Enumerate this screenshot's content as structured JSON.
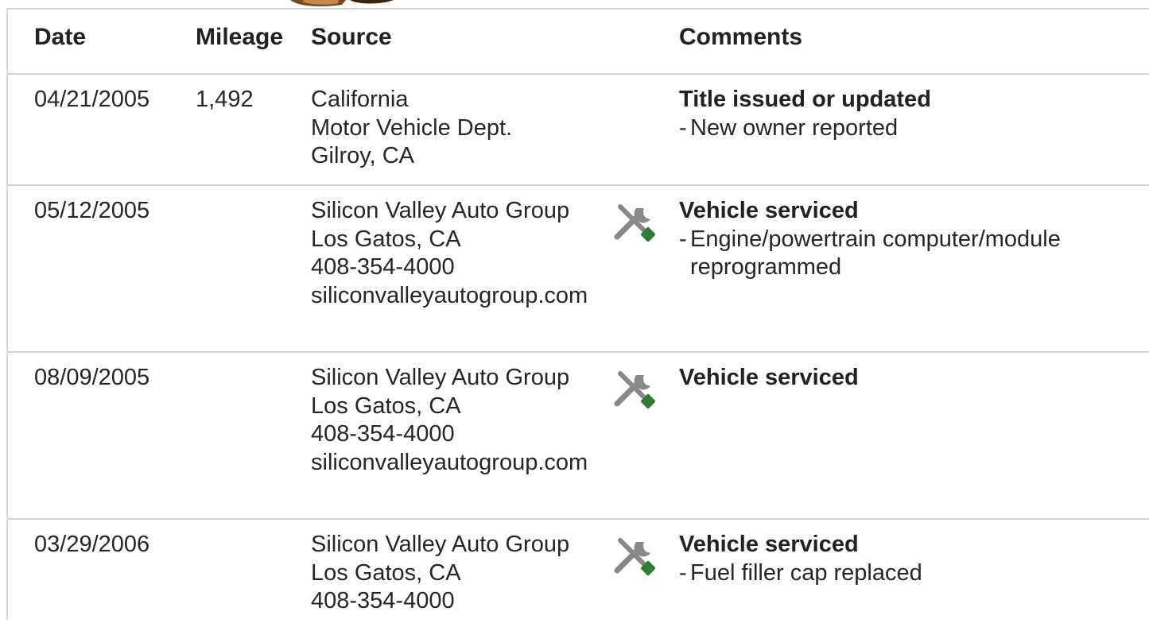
{
  "columns": {
    "date": "Date",
    "mileage": "Mileage",
    "source": "Source",
    "comments": "Comments"
  },
  "rows": [
    {
      "date": "04/21/2005",
      "mileage": "1,492",
      "source": [
        "California",
        "Motor Vehicle Dept.",
        "Gilroy, CA"
      ],
      "icon": "",
      "comment_title": "Title issued or updated",
      "comment_items": [
        "New owner reported"
      ]
    },
    {
      "date": "05/12/2005",
      "mileage": "",
      "source": [
        "Silicon Valley Auto Group",
        "Los Gatos, CA",
        "408-354-4000",
        "siliconvalleyautogroup.com"
      ],
      "icon": "service-wrench-icon",
      "comment_title": "Vehicle serviced",
      "comment_items": [
        "Engine/powertrain computer/module reprogrammed"
      ]
    },
    {
      "date": "08/09/2005",
      "mileage": "",
      "source": [
        "Silicon Valley Auto Group",
        "Los Gatos, CA",
        "408-354-4000",
        "siliconvalleyautogroup.com"
      ],
      "icon": "service-wrench-icon",
      "comment_title": "Vehicle serviced",
      "comment_items": []
    },
    {
      "date": "03/29/2006",
      "mileage": "",
      "source": [
        "Silicon Valley Auto Group",
        "Los Gatos, CA",
        "408-354-4000"
      ],
      "icon": "service-wrench-icon",
      "comment_title": "Vehicle serviced",
      "comment_items": [
        "Fuel filler cap replaced"
      ]
    }
  ],
  "colors": {
    "icon_gray": "#888888",
    "icon_green": "#2e7d32",
    "divider": "#d2d2d2"
  }
}
